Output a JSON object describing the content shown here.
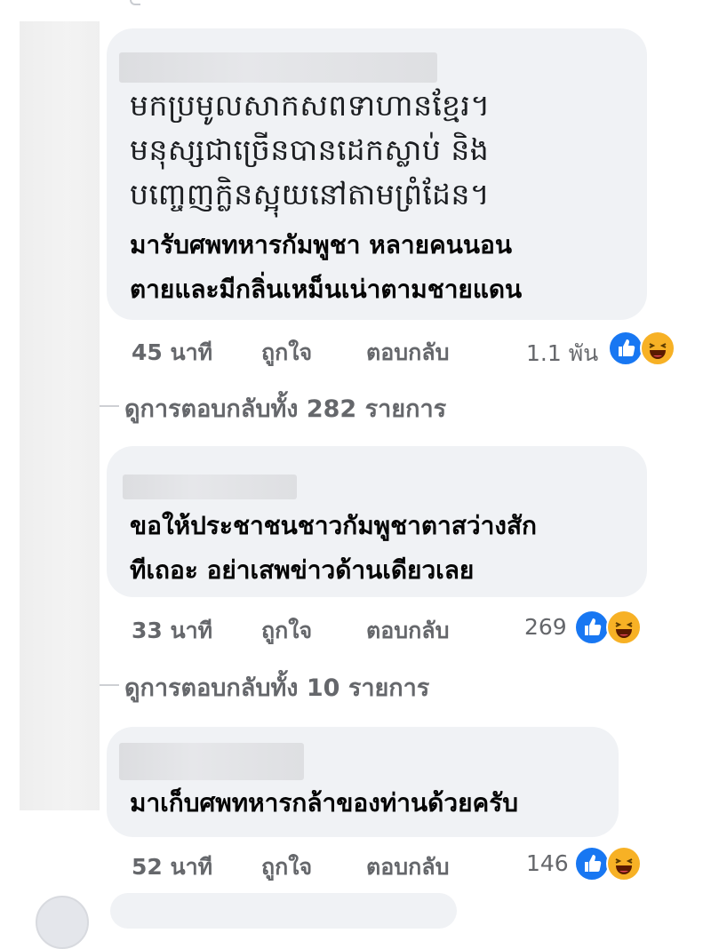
{
  "comments": [
    {
      "khmer_lines": [
        "មកប្រមូលសាកសពទាហានខ្មែរ។",
        "មនុស្សជាច្រើនបានដេកស្លាប់ និង",
        "បញ្ចេញក្លិនស្អុយនៅតាមព្រំដែន។"
      ],
      "thai_lines": [
        "มารับศพทหารกัมพูชา หลายคนนอน",
        "ตายและมีกลิ่นเหม็นเน่าตามชายแดน"
      ],
      "time": "45 นาที",
      "like_label": "ถูกใจ",
      "reply_label": "ตอบกลับ",
      "reaction_count": "1.1 พัน",
      "view_replies": "ดูการตอบกลับทั้ง 282 รายการ"
    },
    {
      "thai_lines": [
        "ขอให้ประชาชนชาวกัมพูชาตาสว่างสัก",
        "ทีเถอะ อย่าเสพข่าวด้านเดียวเลย"
      ],
      "time": "33 นาที",
      "like_label": "ถูกใจ",
      "reply_label": "ตอบกลับ",
      "reaction_count": "269",
      "view_replies": "ดูการตอบกลับทั้ง 10 รายการ"
    },
    {
      "thai_lines": [
        "มาเก็บศพทหารกล้าของท่านด้วยครับ"
      ],
      "time": "52 นาที",
      "like_label": "ถูกใจ",
      "reply_label": "ตอบกลับ",
      "reaction_count": "146"
    }
  ],
  "icons": {
    "like": "like-reaction-icon",
    "haha": "haha-reaction-icon"
  },
  "colors": {
    "bubble": "#f0f2f5",
    "meta_text": "#65676b",
    "like_blue": "#1877f2",
    "haha_yellow": "#f7b125"
  }
}
